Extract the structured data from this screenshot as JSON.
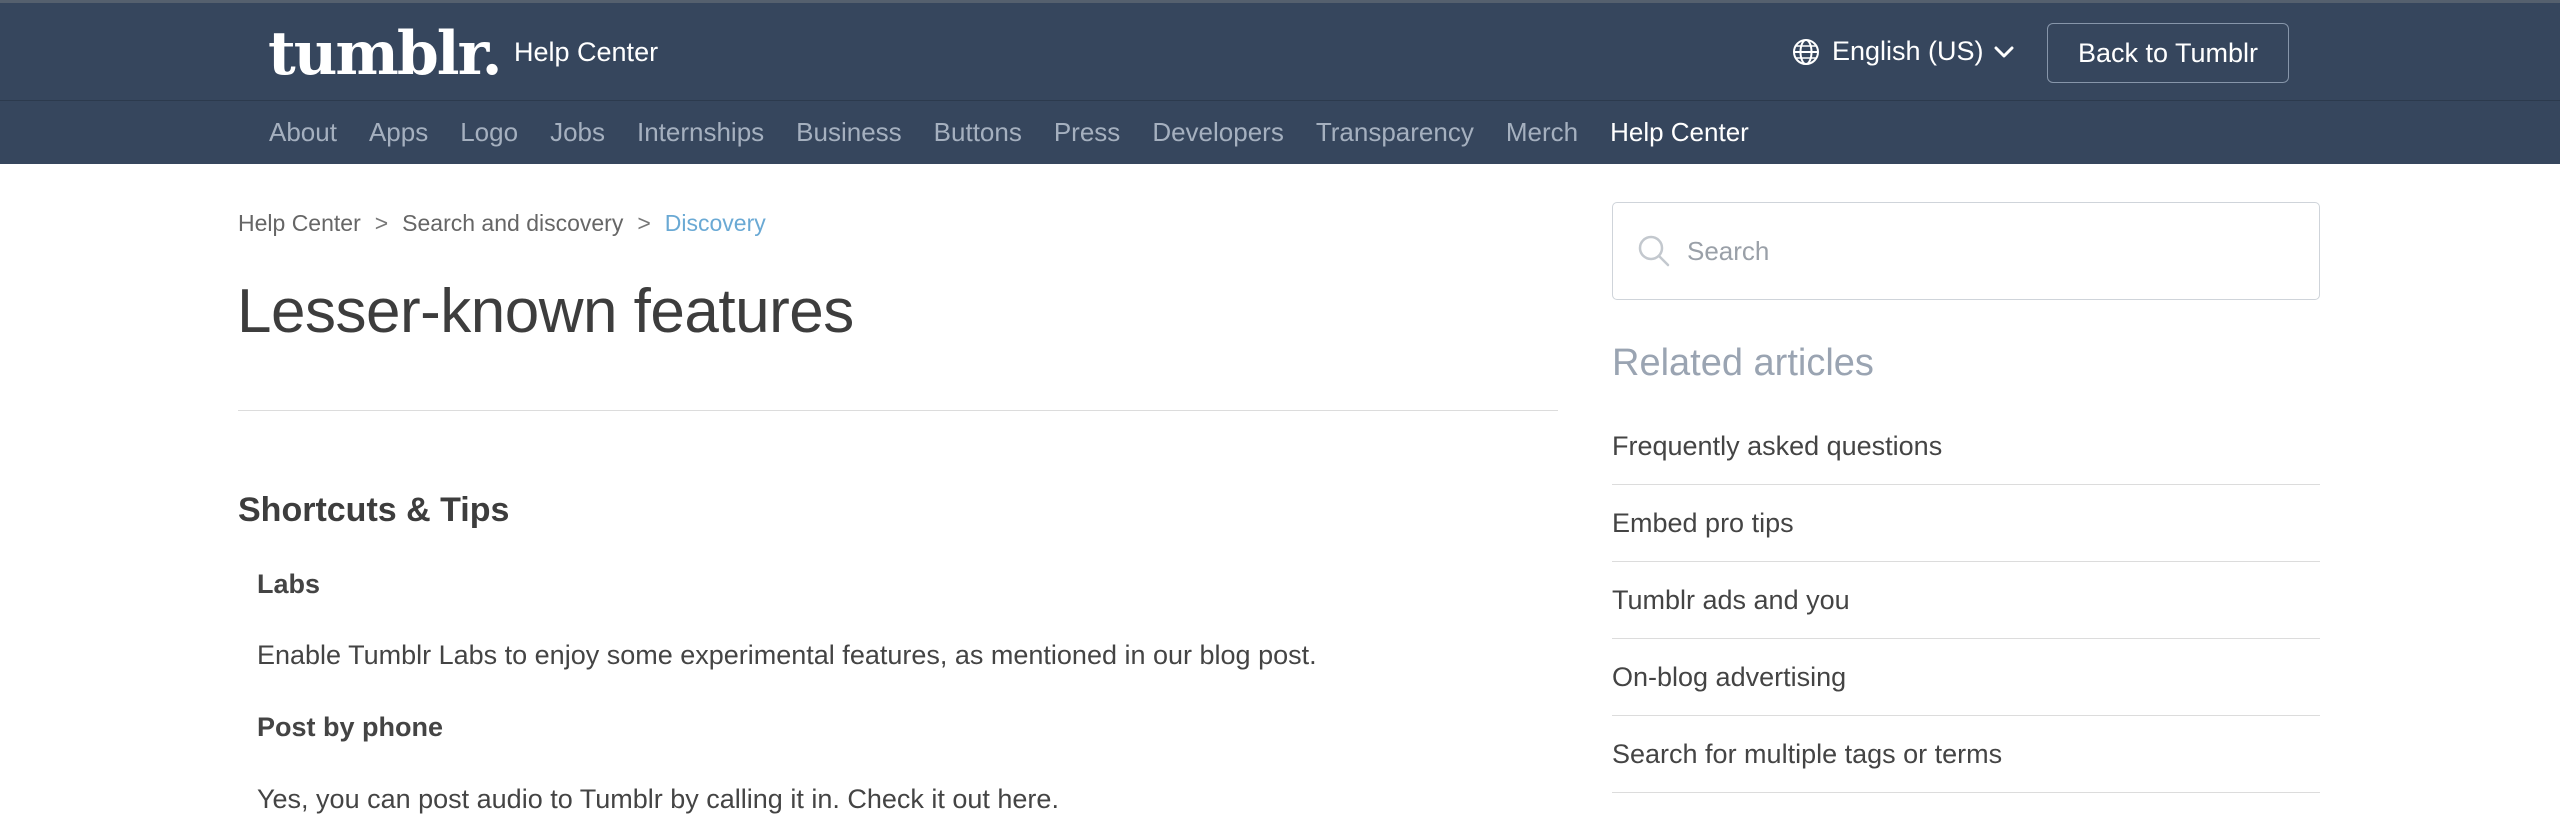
{
  "header": {
    "logo_text": "tumblr.",
    "section_label": "Help Center",
    "language": "English (US)",
    "back_button": "Back to Tumblr"
  },
  "nav": {
    "items": [
      "About",
      "Apps",
      "Logo",
      "Jobs",
      "Internships",
      "Business",
      "Buttons",
      "Press",
      "Developers",
      "Transparency",
      "Merch",
      "Help Center"
    ],
    "active": "Help Center"
  },
  "breadcrumb": {
    "items": [
      "Help Center",
      "Search and discovery",
      "Discovery"
    ],
    "separator": ">"
  },
  "article": {
    "title": "Lesser-known features",
    "section_title": "Shortcuts & Tips",
    "labs_heading": "Labs",
    "labs_text": "Enable Tumblr Labs to enjoy some experimental features, as mentioned in our blog post.",
    "phone_heading": "Post by phone",
    "phone_text": "Yes, you can post audio to Tumblr by calling it in. Check it out here."
  },
  "sidebar": {
    "search_placeholder": "Search",
    "related_title": "Related articles",
    "related": [
      "Frequently asked questions",
      "Embed pro tips",
      "Tumblr ads and you",
      "On-blog advertising",
      "Search for multiple tags or terms"
    ]
  },
  "colors": {
    "header_bg": "#36465d",
    "link_accent": "#6aa9d4",
    "nav_inactive": "#a5b0bf"
  }
}
